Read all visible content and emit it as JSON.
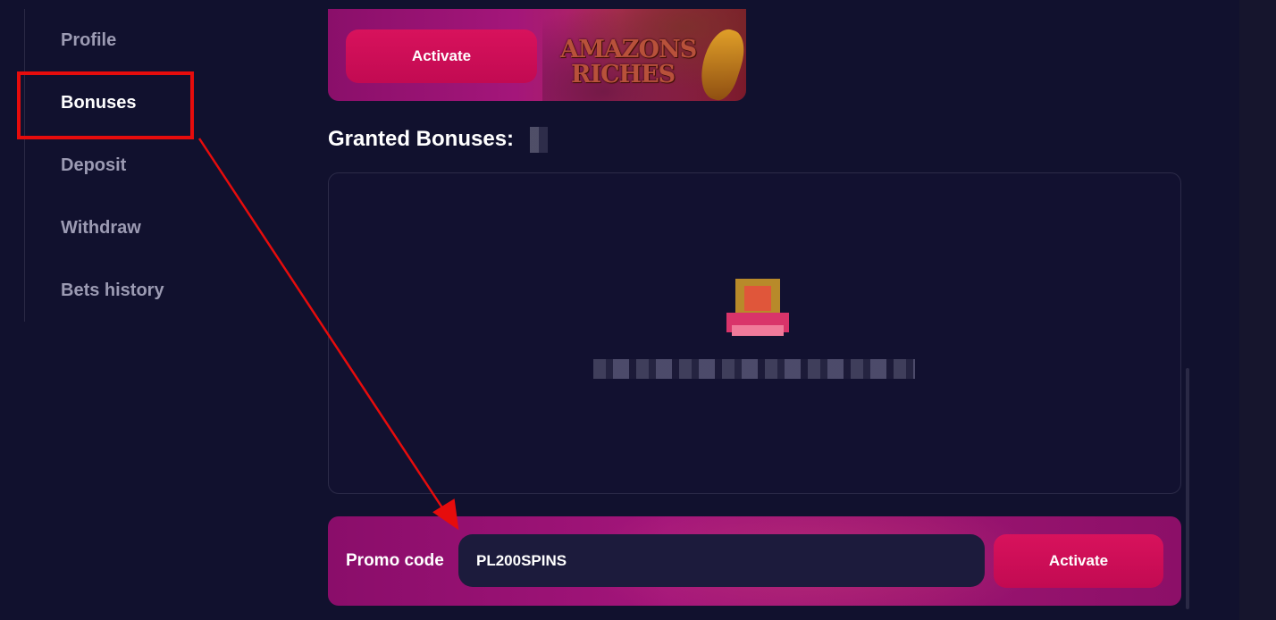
{
  "sidebar": {
    "items": [
      {
        "label": "Profile"
      },
      {
        "label": "Bonuses",
        "active": true
      },
      {
        "label": "Deposit"
      },
      {
        "label": "Withdraw"
      },
      {
        "label": "Bets history"
      }
    ]
  },
  "banner": {
    "activate_label": "Activate",
    "game_logo": {
      "line1": "AMAZONS",
      "line2": "RICHES"
    }
  },
  "granted": {
    "title": "Granted Bonuses:"
  },
  "promo": {
    "label": "Promo code",
    "value": "PL200SPINS",
    "activate_label": "Activate"
  },
  "colors": {
    "background": "#11112e",
    "accent": "#d8125c",
    "annotation": "#e60c0c",
    "promo_gradient": "#a3157a"
  },
  "icons": {
    "empty_state": "gift-icon",
    "annotation_arrow": "arrow-icon"
  }
}
